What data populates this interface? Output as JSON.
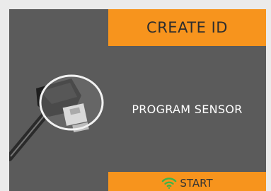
{
  "header": {
    "title": "CREATE ID"
  },
  "main": {
    "message": "PROGRAM SENSOR"
  },
  "footer": {
    "start_label": "START",
    "start_icon": "wifi-icon"
  },
  "illustration": {
    "icon": "tpms-sensor-magnifier-icon"
  },
  "colors": {
    "accent": "#f7941d",
    "screen_bg": "#5b5b5b",
    "page_bg": "#ebebeb",
    "title_text": "#2e2e2e",
    "main_text": "#ffffff",
    "wifi_green": "#3cb44a"
  }
}
